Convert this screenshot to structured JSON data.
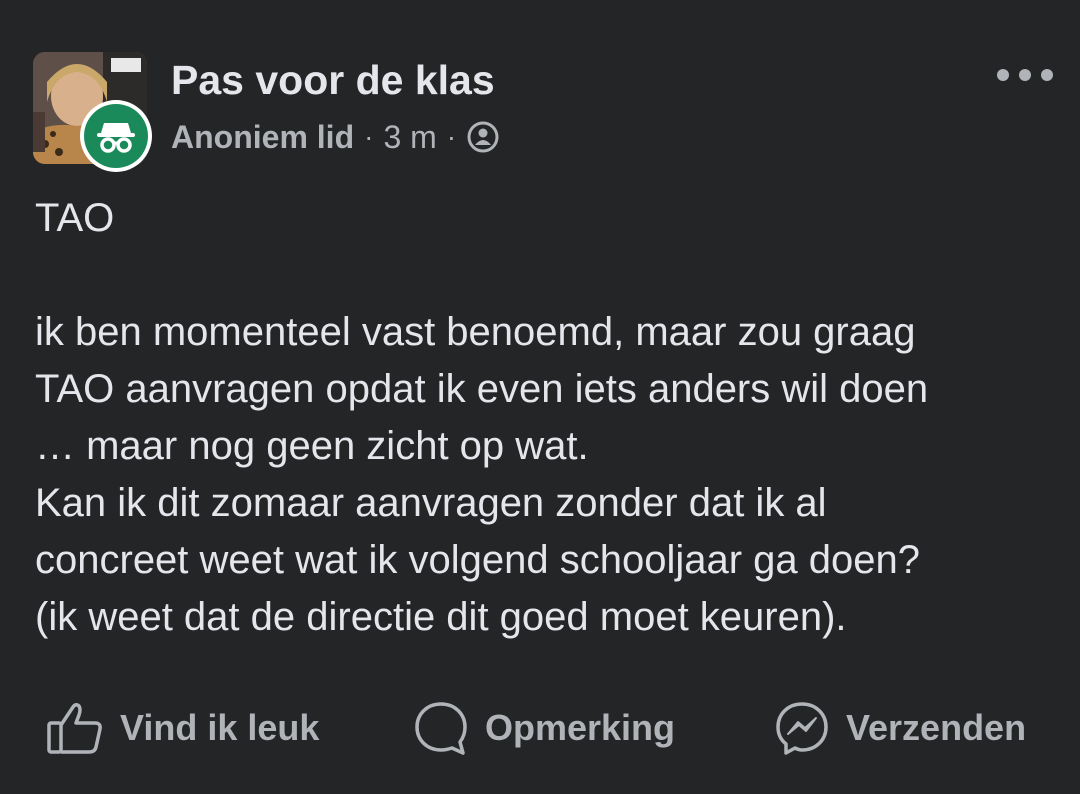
{
  "header": {
    "group_name": "Pas voor de klas",
    "author": "Anoniem lid",
    "separator": "·",
    "time": "3 m",
    "privacy_icon": "group-members-icon",
    "more_icon": "more-options-icon"
  },
  "post": {
    "title_line": "TAO",
    "lines": [
      "ik ben momenteel vast benoemd, maar zou graag",
      "TAO aanvragen opdat ik even iets anders wil doen",
      "… maar nog geen zicht op wat.",
      "Kan ik dit zomaar aanvragen zonder dat ik al",
      "concreet weet wat ik volgend schooljaar ga doen?",
      "(ik weet dat de directie dit goed moet keuren)."
    ]
  },
  "actions": {
    "like_label": "Vind ik leuk",
    "comment_label": "Opmerking",
    "share_label": "Verzenden"
  },
  "colors": {
    "background": "#242526",
    "primary_text": "#e4e6eb",
    "secondary_text": "#b0b3b8",
    "anon_badge": "#1a8a5a"
  }
}
